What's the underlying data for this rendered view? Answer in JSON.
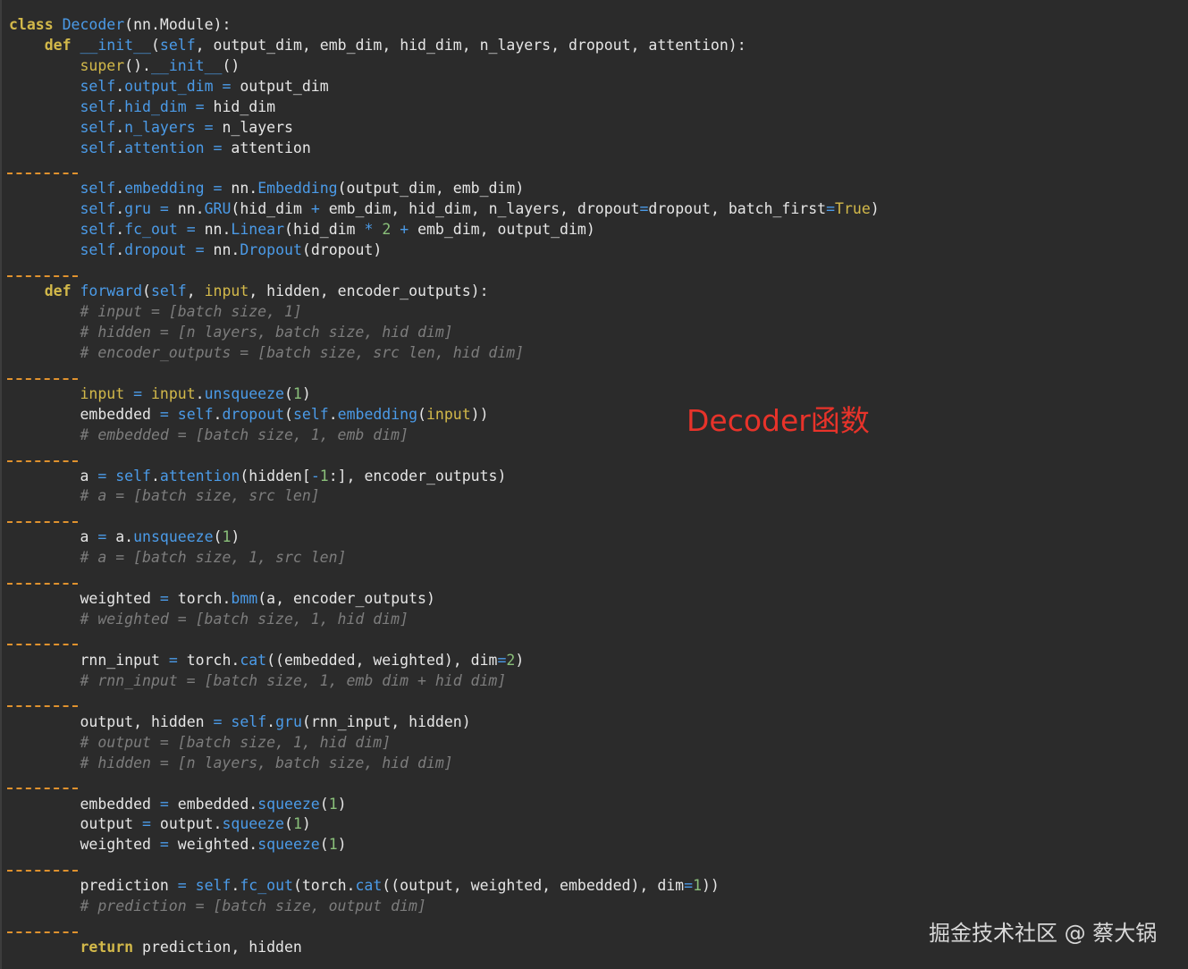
{
  "code": {
    "l1": "class Decoder(nn.Module):",
    "l2": "    def __init__(self, output_dim, emb_dim, hid_dim, n_layers, dropout, attention):",
    "l3": "        super().__init__()",
    "l4": "        self.output_dim = output_dim",
    "l5": "        self.hid_dim = hid_dim",
    "l6": "        self.n_layers = n_layers",
    "l7": "        self.attention = attention",
    "l8": "        self.embedding = nn.Embedding(output_dim, emb_dim)",
    "l9": "        self.gru = nn.GRU(hid_dim + emb_dim, hid_dim, n_layers, dropout=dropout, batch_first=True)",
    "l10": "        self.fc_out = nn.Linear(hid_dim * 2 + emb_dim, output_dim)",
    "l11": "        self.dropout = nn.Dropout(dropout)",
    "l12": "    def forward(self, input, hidden, encoder_outputs):",
    "l13": "        # input = [batch size, 1]",
    "l14": "        # hidden = [n layers, batch size, hid dim]",
    "l15": "        # encoder_outputs = [batch size, src len, hid dim]",
    "l16": "        input = input.unsqueeze(1)",
    "l17": "        embedded = self.dropout(self.embedding(input))",
    "l18": "        # embedded = [batch size, 1, emb dim]",
    "l19": "        a = self.attention(hidden[-1:], encoder_outputs)",
    "l20": "        # a = [batch size, src len]",
    "l21": "        a = a.unsqueeze(1)",
    "l22": "        # a = [batch size, 1, src len]",
    "l23": "        weighted = torch.bmm(a, encoder_outputs)",
    "l24": "        # weighted = [batch size, 1, hid dim]",
    "l25": "        rnn_input = torch.cat((embedded, weighted), dim=2)",
    "l26": "        # rnn_input = [batch size, 1, emb dim + hid dim]",
    "l27": "        output, hidden = self.gru(rnn_input, hidden)",
    "l28": "        # output = [batch size, 1, hid dim]",
    "l29": "        # hidden = [n layers, batch size, hid dim]",
    "l30": "        embedded = embedded.squeeze(1)",
    "l31": "        output = output.squeeze(1)",
    "l32": "        weighted = weighted.squeeze(1)",
    "l33": "        prediction = self.fc_out(torch.cat((output, weighted, embedded), dim=1))",
    "l34": "        # prediction = [batch size, output dim]",
    "l35": "        return prediction, hidden"
  },
  "annotation": "Decoder函数",
  "watermark": "掘金技术社区 @ 蔡大锅",
  "colors": {
    "background": "#2b2b2b",
    "keyword": "#d3b94a",
    "identifier_blue": "#4b9be8",
    "number": "#8ac07a",
    "comment": "#7d7d7d",
    "separator": "#e0922e",
    "annotation": "#e8332a"
  }
}
